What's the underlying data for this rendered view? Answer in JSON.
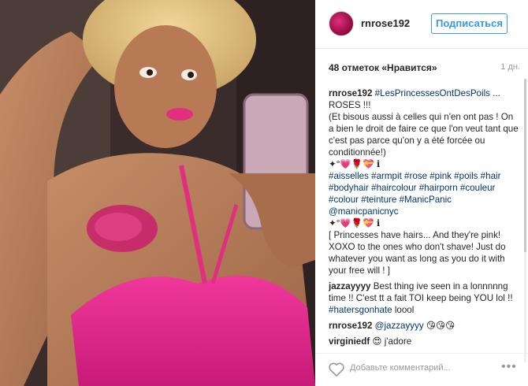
{
  "post": {
    "username": "rnrose192",
    "subscribe_label": "Подписаться",
    "likes": "48 отметок «Нравится»",
    "age": "1 дн.",
    "caption": {
      "user": "rnrose192",
      "tag": "#LesPrincessesOntDesPoils",
      "rest": " ... ROSES !!!\n(Et bisous aussi à celles qui n'en ont pas ! On a bien le droit de faire ce que l'on veut tant que c'est pas parce qu'on y a été forcée ou conditionnée!)\n✦°💗🌹💝 ℹ",
      "hashtags": "#aisselles #armpit #rose #pink #poils #hair #bodyhair #haircolour #hairporn #couleur #colour #teinture #ManicPanic @manicpanicnyc",
      "emoji2": "✦°💗🌹💝 ℹ",
      "english": "[ Princesses have hairs... And they're pink!\nXOXO to the ones who don't shave! Just do whatever you want as long as you do it with your free will ! ]"
    },
    "comment1": {
      "user": "jazzayyyy",
      "text": " Best thing ive seen in a lonnnnng time !! C'est tt a fait TOI keep being YOU lol !! ",
      "tag": "#hatersgonhate",
      "after": " loool"
    },
    "comment2": {
      "user": "rnrose192",
      "mention": "@jazzayyyy",
      "after": " 😘😘😘"
    },
    "comment3": {
      "user": "virginiedf",
      "after": " 😍 j'adore"
    },
    "add_comment_placeholder": "Добавьте комментарий...",
    "more_label": "•••"
  },
  "icons": {
    "heart": "heart-icon",
    "more": "more-options-icon"
  },
  "colors": {
    "accent": "#3897f0",
    "link": "#003569",
    "pink": "#e0307a"
  }
}
